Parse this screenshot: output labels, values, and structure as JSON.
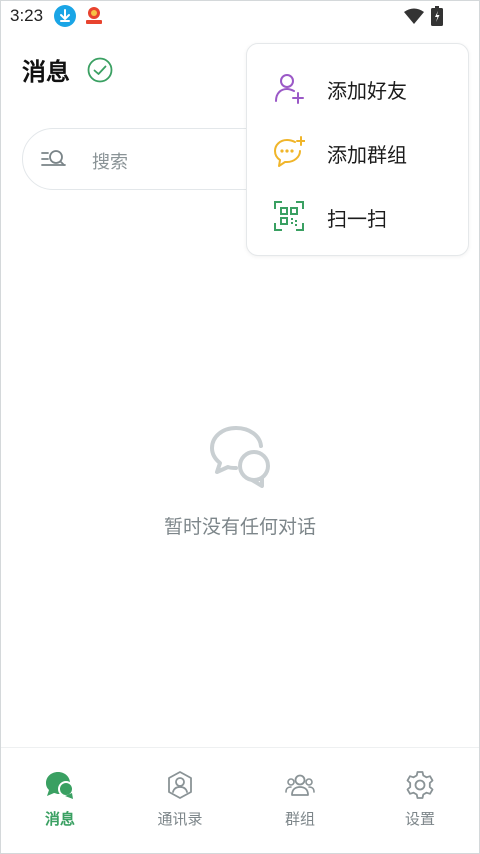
{
  "status_bar": {
    "time": "3:23",
    "icons": [
      "download-app-icon",
      "red-app-icon",
      "wifi-icon",
      "battery-icon"
    ]
  },
  "header": {
    "title": "消息",
    "verified_icon": "check-circle-icon"
  },
  "search": {
    "placeholder": "搜索",
    "icon": "search-list-icon"
  },
  "menu": {
    "items": [
      {
        "label": "添加好友",
        "icon": "add-friend-icon",
        "color": "#9b59c7"
      },
      {
        "label": "添加群组",
        "icon": "add-group-chat-icon",
        "color": "#f0b52a"
      },
      {
        "label": "扫一扫",
        "icon": "qr-scan-icon",
        "color": "#3aa062"
      }
    ]
  },
  "empty_state": {
    "icon": "chat-bubbles-icon",
    "text": "暂时没有任何对话"
  },
  "bottom_nav": {
    "active": 0,
    "items": [
      {
        "label": "消息",
        "icon": "messages-icon"
      },
      {
        "label": "通讯录",
        "icon": "contacts-icon"
      },
      {
        "label": "群组",
        "icon": "groups-icon"
      },
      {
        "label": "设置",
        "icon": "settings-icon"
      }
    ]
  },
  "colors": {
    "accent": "#3aa062",
    "muted": "#7d868a",
    "purple": "#9b59c7",
    "yellow": "#f0b52a"
  }
}
